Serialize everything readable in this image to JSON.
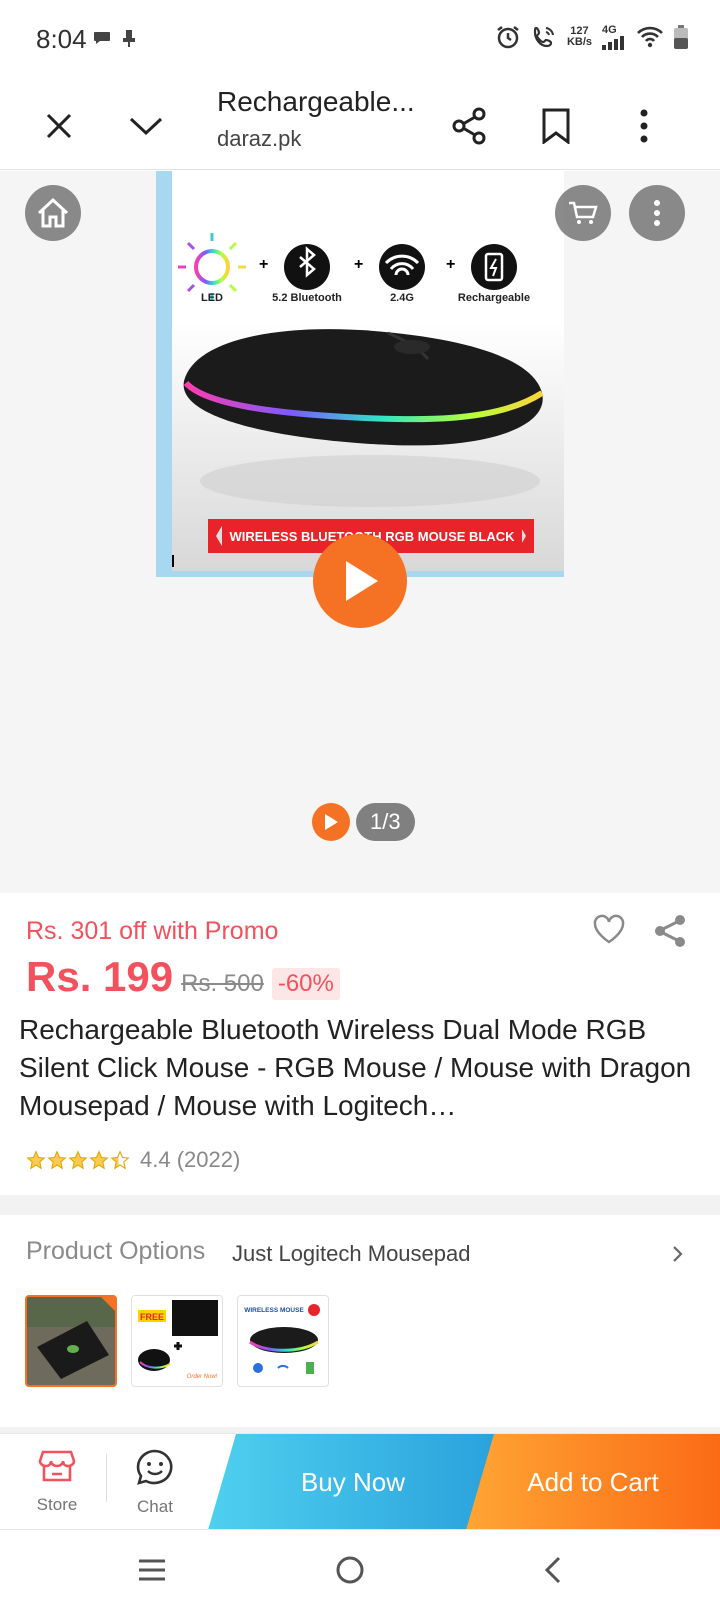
{
  "status_bar": {
    "time": "8:04",
    "speed_value": "127",
    "speed_unit": "KB/s",
    "network": "4G"
  },
  "browser": {
    "title": "Rechargeable...",
    "domain": "daraz.pk"
  },
  "media": {
    "feature_labels": [
      "LED",
      "5.2 Bluetooth",
      "2.4G",
      "Rechargeable"
    ],
    "banner_text": "WIRELESS BLUETOOTH RGB MOUSE BLACK",
    "counter": "1/3"
  },
  "product": {
    "promo": "Rs. 301 off with Promo",
    "price": "Rs. 199",
    "old_price": "Rs. 500",
    "discount": "-60%",
    "title": "Rechargeable Bluetooth Wireless Dual Mode RGB Silent Click Mouse - RGB Mouse / Mouse with Dragon Mousepad / Mouse with Logitech…",
    "rating": 4.4,
    "rating_text": "4.4 (2022)"
  },
  "options": {
    "label": "Product Options",
    "value": "Just Logitech Mousepad",
    "thumbs": [
      {
        "selected": true
      },
      {
        "badge": "FREE",
        "footer": "Order Now!"
      },
      {
        "heading": "WIRELESS MOUSE"
      }
    ]
  },
  "actions": {
    "store": "Store",
    "chat": "Chat",
    "buy_now": "Buy Now",
    "add_to_cart": "Add to Cart"
  },
  "colors": {
    "accent": "#f57224",
    "price": "#f2515d",
    "buy_now": "#2aa1dc",
    "add_to_cart": "#fb6b16"
  }
}
